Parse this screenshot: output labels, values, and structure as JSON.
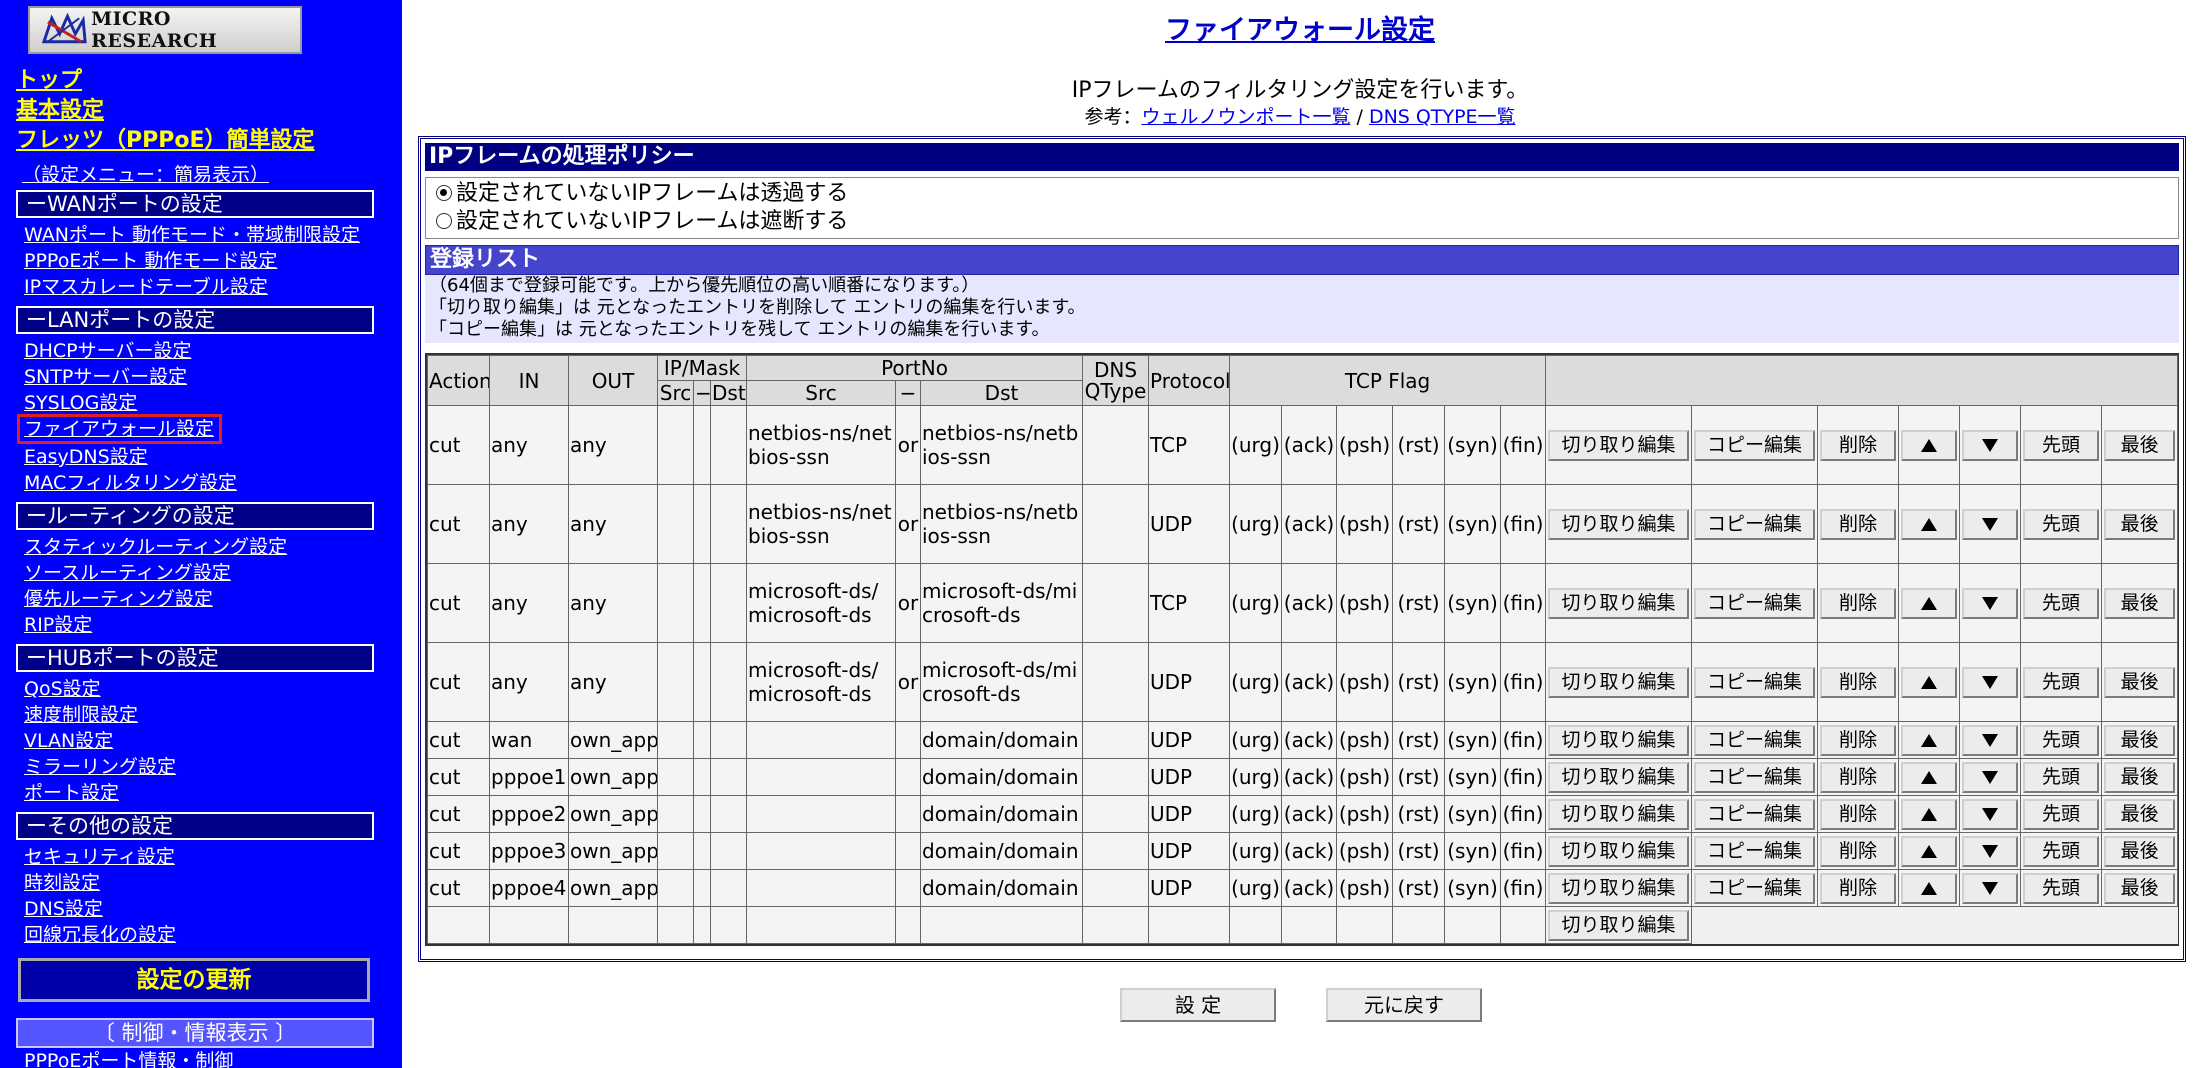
{
  "sidebar": {
    "logo_text": "MICRO RESEARCH",
    "top_links": [
      "トップ",
      "基本設定",
      "フレッツ（PPPoE）簡単設定"
    ],
    "menu_mode": "（設定メニュー：簡易表示）",
    "sections": [
      {
        "title": "ーWANポートの設定",
        "items": [
          "WANポート 動作モード・帯域制限設定",
          "PPPoEポート 動作モード設定",
          "IPマスカレードテーブル設定"
        ]
      },
      {
        "title": "ーLANポートの設定",
        "items": [
          "DHCPサーバー設定",
          "SNTPサーバー設定",
          "SYSLOG設定",
          "ファイアウォール設定",
          "EasyDNS設定",
          "MACフィルタリング設定"
        ]
      },
      {
        "title": "ールーティングの設定",
        "items": [
          "スタティックルーティング設定",
          "ソースルーティング設定",
          "優先ルーティング設定",
          "RIP設定"
        ]
      },
      {
        "title": "ーHUBポートの設定",
        "items": [
          "QoS設定",
          "速度制限設定",
          "VLAN設定",
          "ミラーリング設定",
          "ポート設定"
        ]
      },
      {
        "title": "ーその他の設定",
        "items": [
          "セキュリティ設定",
          "時刻設定",
          "DNS設定",
          "回線冗長化の設定"
        ]
      }
    ],
    "update_button": "設定の更新",
    "control_header": "〔 制御・情報表示 〕",
    "control_first_item": "PPPoEポート情報・制御"
  },
  "main": {
    "title": "ファイアウォール設定",
    "description": "IPフレームのフィルタリング設定を行います。",
    "ref_prefix": "参考：",
    "ref_link1": "ウェルノウンポート一覧",
    "ref_sep": " / ",
    "ref_link2": "DNS QTYPE一覧",
    "policy_header": "IPフレームの処理ポリシー",
    "policy_options": [
      "設定されていないIPフレームは透過する",
      "設定されていないIPフレームは遮断する"
    ],
    "policy_selected": 0,
    "list_header": "登録リスト",
    "notes": [
      "（64個まで登録可能です。上から優先順位の高い順番になります。）",
      "「切り取り編集」は 元となったエントリを削除して エントリの編集を行います。",
      "「コピー編集」は 元となったエントリを残して エントリの編集を行います。"
    ],
    "table_headers": {
      "action": "Action",
      "in": "IN",
      "out": "OUT",
      "ipmask": "IP/Mask",
      "portno": "PortNo",
      "dns_qtype": "DNS QType",
      "protocol": "Protocol",
      "tcp_flag": "TCP Flag",
      "src": "Src",
      "dash": "−",
      "dst": "Dst"
    },
    "flags": [
      "(urg)",
      "(ack)",
      "(psh)",
      "(rst)",
      "(syn)",
      "(fin)"
    ],
    "row_buttons": {
      "cut_edit": "切り取り編集",
      "copy_edit": "コピー編集",
      "delete": "削除",
      "first": "先頭",
      "last": "最後"
    },
    "rows": [
      {
        "action": "cut",
        "in": "any",
        "out": "any",
        "src_port": "netbios-ns/netbios-ssn",
        "op": "or",
        "dst_port": "netbios-ns/netbios-ssn",
        "protocol": "TCP"
      },
      {
        "action": "cut",
        "in": "any",
        "out": "any",
        "src_port": "netbios-ns/netbios-ssn",
        "op": "or",
        "dst_port": "netbios-ns/netbios-ssn",
        "protocol": "UDP"
      },
      {
        "action": "cut",
        "in": "any",
        "out": "any",
        "src_port": "microsoft-ds/microsoft-ds",
        "op": "or",
        "dst_port": "microsoft-ds/microsoft-ds",
        "protocol": "TCP"
      },
      {
        "action": "cut",
        "in": "any",
        "out": "any",
        "src_port": "microsoft-ds/microsoft-ds",
        "op": "or",
        "dst_port": "microsoft-ds/microsoft-ds",
        "protocol": "UDP"
      },
      {
        "action": "cut",
        "in": "wan",
        "out": "own_app",
        "src_port": "",
        "op": "",
        "dst_port": "domain/domain",
        "protocol": "UDP"
      },
      {
        "action": "cut",
        "in": "pppoe1",
        "out": "own_app",
        "src_port": "",
        "op": "",
        "dst_port": "domain/domain",
        "protocol": "UDP"
      },
      {
        "action": "cut",
        "in": "pppoe2",
        "out": "own_app",
        "src_port": "",
        "op": "",
        "dst_port": "domain/domain",
        "protocol": "UDP"
      },
      {
        "action": "cut",
        "in": "pppoe3",
        "out": "own_app",
        "src_port": "",
        "op": "",
        "dst_port": "domain/domain",
        "protocol": "UDP"
      },
      {
        "action": "cut",
        "in": "pppoe4",
        "out": "own_app",
        "src_port": "",
        "op": "",
        "dst_port": "domain/domain",
        "protocol": "UDP"
      }
    ],
    "submit_button": "設 定",
    "reset_button": "元に戻す"
  }
}
